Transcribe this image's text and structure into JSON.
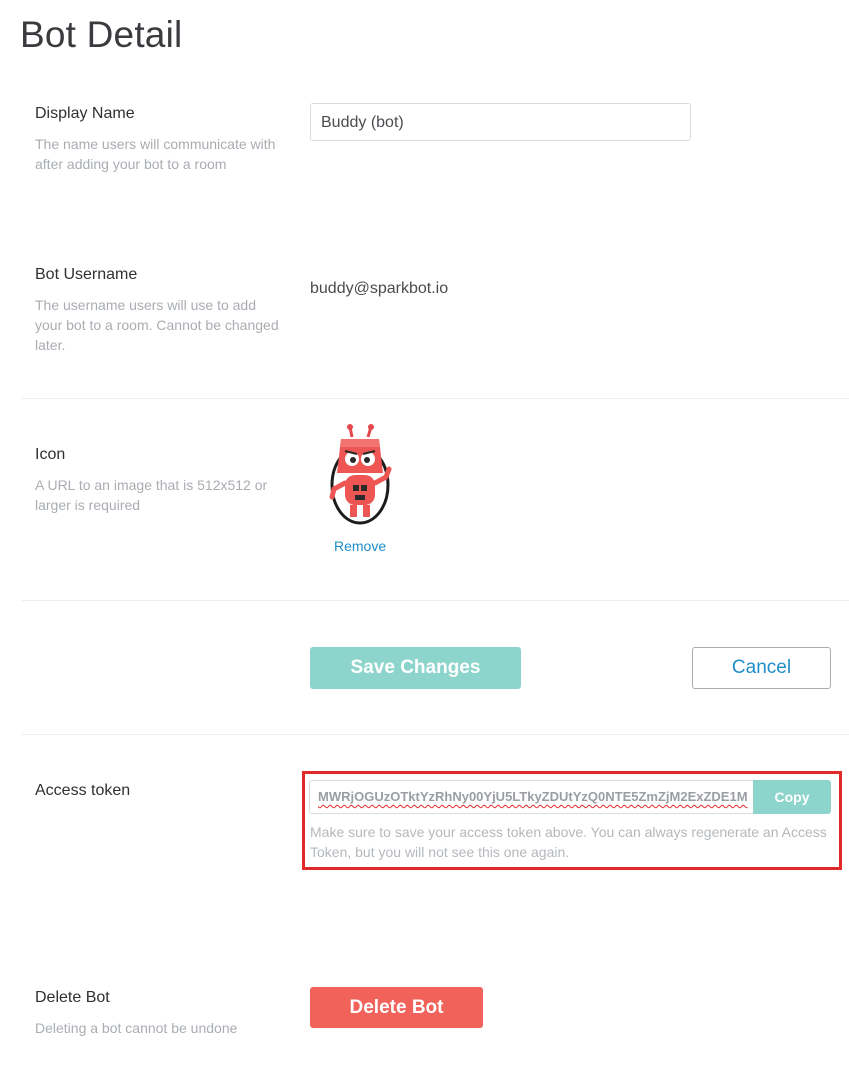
{
  "page": {
    "title": "Bot Detail"
  },
  "display_name": {
    "label": "Display Name",
    "help": "The name users will communicate with after adding your bot to a room",
    "value": "Buddy (bot)"
  },
  "bot_username": {
    "label": "Bot Username",
    "help": "The username users will use to add your bot to a room. Cannot be changed later.",
    "value": "buddy@sparkbot.io"
  },
  "icon": {
    "label": "Icon",
    "help": "A URL to an image that is 512x512 or larger is required",
    "remove_label": "Remove",
    "image_name": "robot-avatar-icon"
  },
  "actions": {
    "save_label": "Save Changes",
    "cancel_label": "Cancel"
  },
  "access_token": {
    "label": "Access token",
    "value": "MWRjOGUzOTktYzRhNy00YjU5LTkyZDUtYzQ0NTE5ZmZjM2ExZDE1M",
    "copy_label": "Copy",
    "help": "Make sure to save your access token above. You can always regenerate an Access Token, but you will not see this one again."
  },
  "delete_bot": {
    "label": "Delete Bot",
    "help": "Deleting a bot cannot be undone",
    "button_label": "Delete Bot"
  },
  "colors": {
    "accent_teal": "#8dd5cc",
    "link_blue": "#1e8fc9",
    "danger_red": "#f1625a",
    "highlight_red": "#e2292a"
  }
}
